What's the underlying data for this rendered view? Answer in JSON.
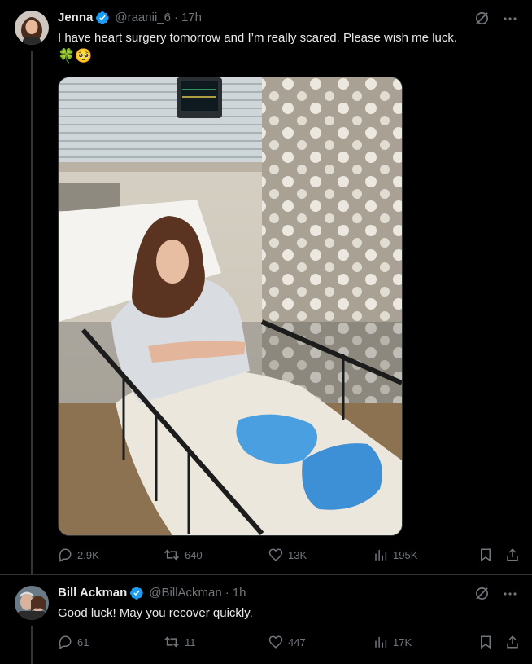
{
  "tweets": [
    {
      "author": {
        "name": "Jenna",
        "handle": "@raanii_6",
        "time": "17h",
        "verified": true
      },
      "text": "I have heart surgery tomorrow and I’m really scared. Please wish me luck.",
      "emojis": "🍀🥺",
      "stats": {
        "replies": "2.9K",
        "reposts": "640",
        "likes": "13K",
        "views": "195K"
      }
    },
    {
      "author": {
        "name": "Bill Ackman",
        "handle": "@BillAckman",
        "time": "1h",
        "verified": true
      },
      "text": "Good luck! May you recover quickly.",
      "stats": {
        "replies": "61",
        "reposts": "11",
        "likes": "447",
        "views": "17K"
      }
    }
  ],
  "icons": {
    "verified": "verified-badge-icon",
    "grok": "grok-icon",
    "more": "more-icon",
    "reply": "reply-icon",
    "repost": "repost-icon",
    "like": "like-icon",
    "views": "views-icon",
    "bookmark": "bookmark-icon",
    "share": "share-icon"
  },
  "colors": {
    "background": "#000000",
    "text": "#e7e9ea",
    "muted": "#71767b",
    "verified": "#1d9bf0"
  }
}
